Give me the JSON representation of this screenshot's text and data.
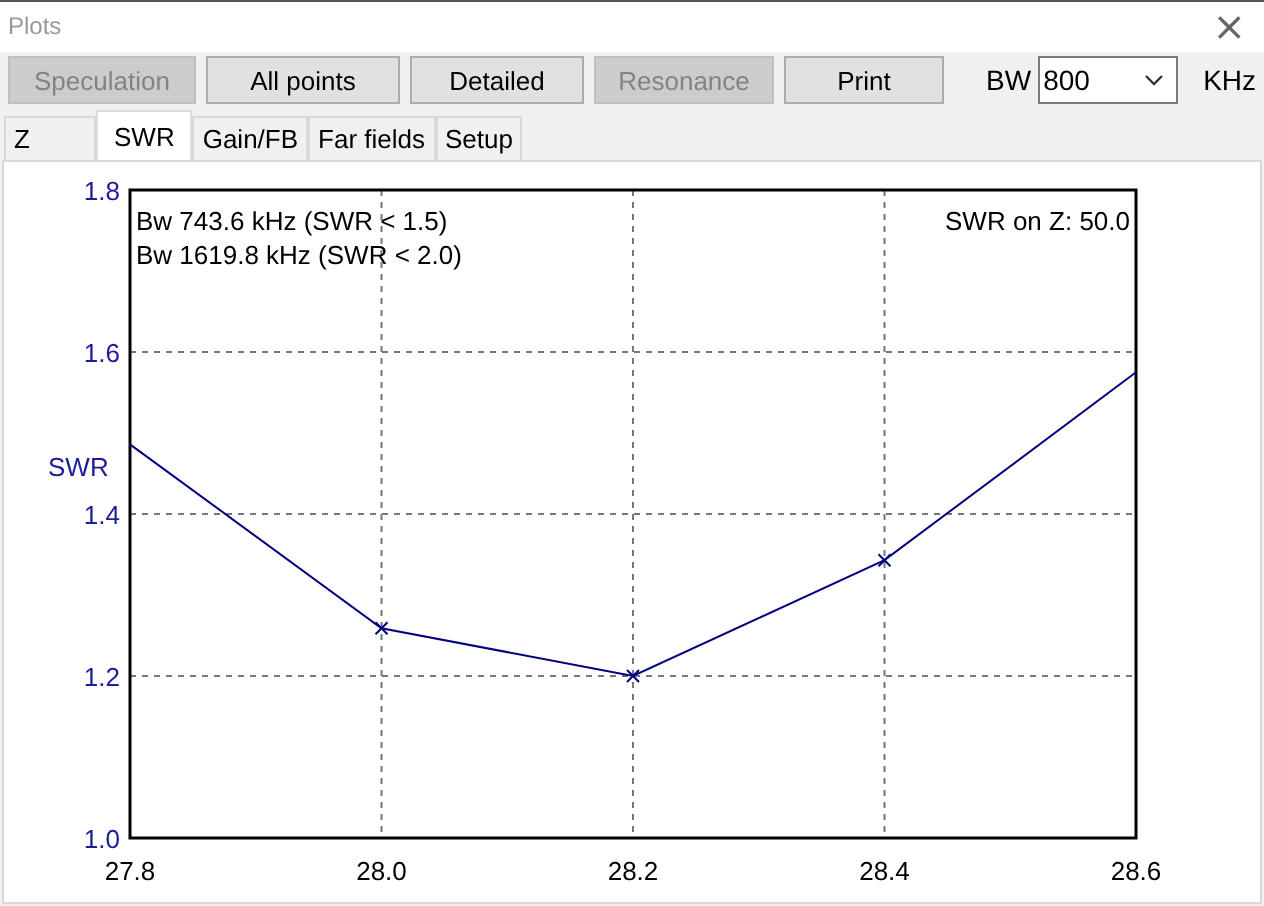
{
  "window": {
    "title": "Plots",
    "close": "×"
  },
  "toolbar": {
    "buttons": [
      {
        "label": "Speculation",
        "disabled": true
      },
      {
        "label": "All points",
        "disabled": false
      },
      {
        "label": "Detailed",
        "disabled": false
      },
      {
        "label": "Resonance",
        "disabled": true
      },
      {
        "label": "Print",
        "disabled": false
      }
    ],
    "bw_label": "BW",
    "bw_value": "800",
    "bw_unit": "KHz"
  },
  "tabs": [
    {
      "label": "Z",
      "selected": false
    },
    {
      "label": "SWR",
      "selected": true
    },
    {
      "label": "Gain/FB",
      "selected": false
    },
    {
      "label": "Far fields",
      "selected": false
    },
    {
      "label": "Setup",
      "selected": false
    }
  ],
  "chart_data": {
    "type": "line",
    "ylabel": "SWR",
    "x": [
      27.8,
      28.0,
      28.2,
      28.4,
      28.6
    ],
    "grid": true,
    "series": [
      {
        "color": "#000080",
        "values": [
          1.486,
          1.259,
          1.2,
          1.343,
          1.575
        ]
      }
    ],
    "xlim": [
      27.8,
      28.6
    ],
    "ylim": [
      1.0,
      1.8
    ],
    "xticks": [
      {
        "value": 27.8,
        "label": "27.8"
      },
      {
        "value": 28.0,
        "label": "28.0"
      },
      {
        "value": 28.2,
        "label": "28.2"
      },
      {
        "value": 28.4,
        "label": "28.4"
      },
      {
        "value": 28.6,
        "label": "28.6"
      }
    ],
    "yticks": [
      {
        "value": 1.0,
        "label": "1.0"
      },
      {
        "value": 1.2,
        "label": "1.2"
      },
      {
        "value": 1.4,
        "label": "1.4"
      },
      {
        "value": 1.6,
        "label": "1.6"
      },
      {
        "value": 1.8,
        "label": "1.8"
      }
    ],
    "annotations": [
      "Bw 743.6 kHz (SWR < 1.5)",
      "Bw 1619.8 kHz (SWR < 2.0)",
      "SWR on Z: 50.0"
    ]
  }
}
